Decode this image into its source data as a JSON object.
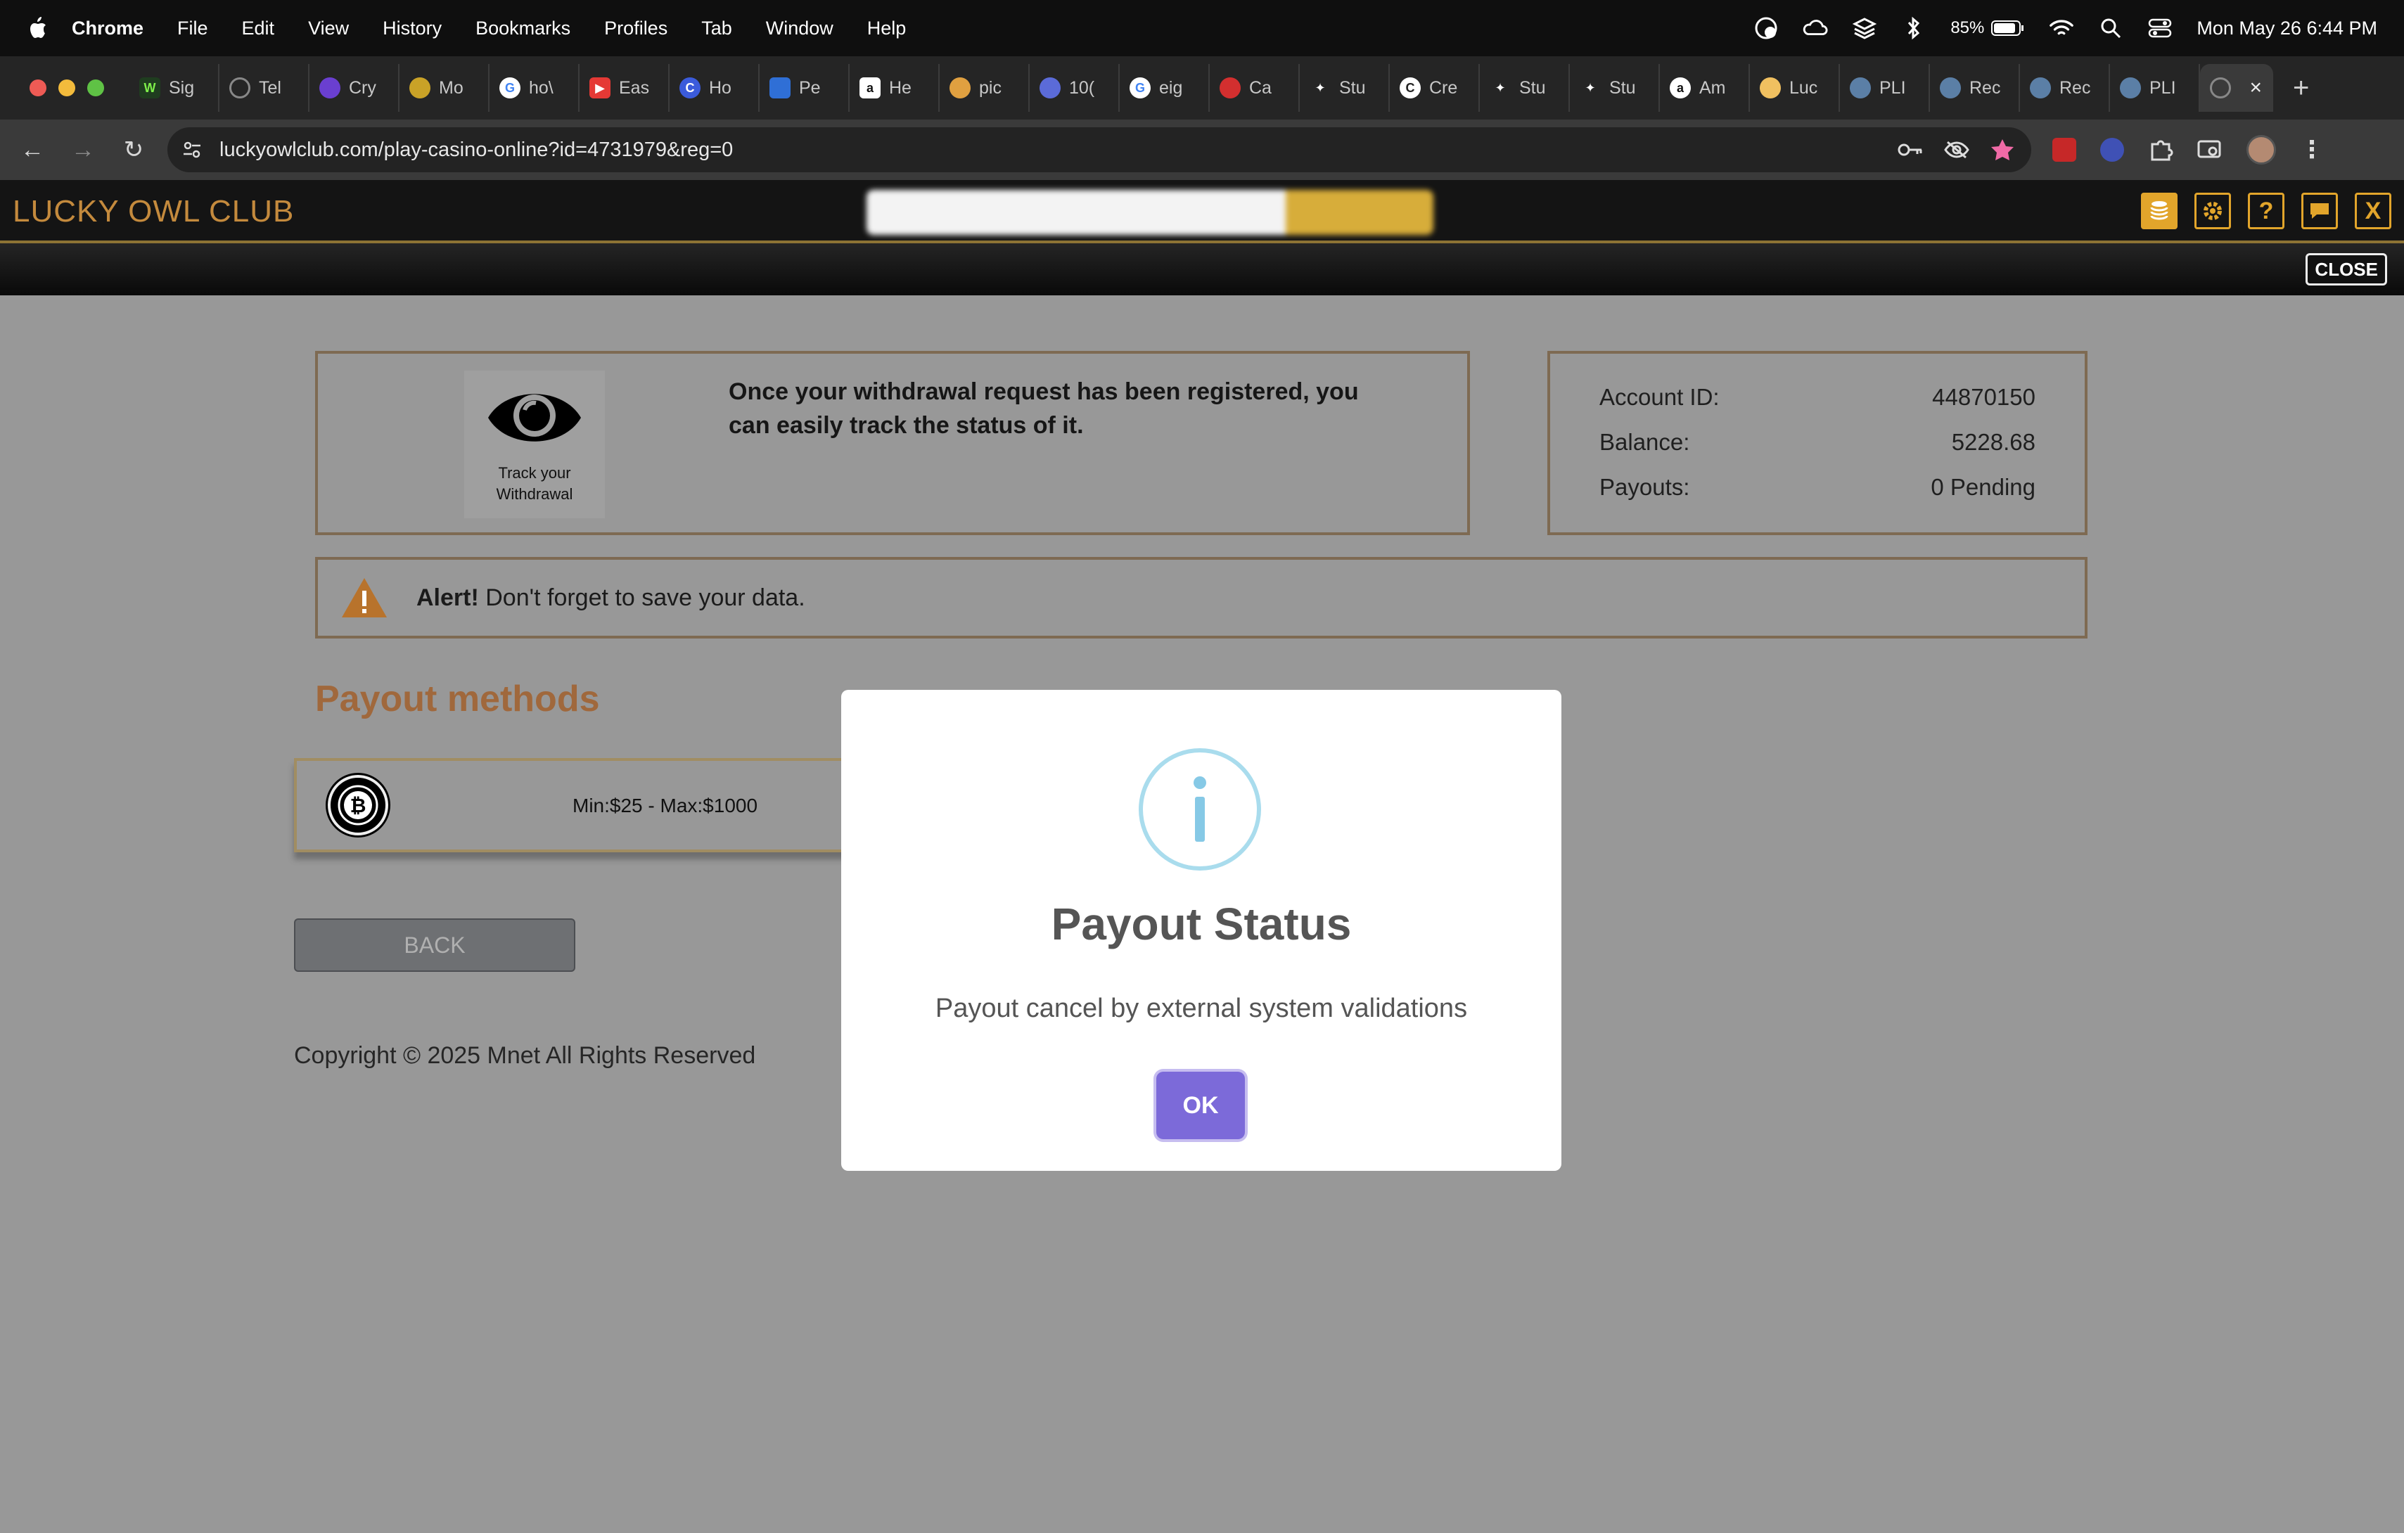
{
  "menubar": {
    "app": "Chrome",
    "items": [
      "File",
      "Edit",
      "View",
      "History",
      "Bookmarks",
      "Profiles",
      "Tab",
      "Window",
      "Help"
    ],
    "battery": "85%",
    "datetime": "Mon May 26  6:44 PM"
  },
  "tabs": [
    {
      "label": "Sig",
      "color": "#1f3d1f"
    },
    {
      "label": "Tel",
      "color": "#555555"
    },
    {
      "label": "Cry",
      "color": "#6a3fd0"
    },
    {
      "label": "Mo",
      "color": "#c9a227"
    },
    {
      "label": "ho\\",
      "color": "#4285f4"
    },
    {
      "label": "Eas",
      "color": "#e53935"
    },
    {
      "label": "Ho",
      "color": "#3b5bdb"
    },
    {
      "label": "Pe",
      "color": "#2f6fd6"
    },
    {
      "label": "He",
      "color": "#ffffff"
    },
    {
      "label": "pic",
      "color": "#e0a040"
    },
    {
      "label": "10(",
      "color": "#5b6bd8"
    },
    {
      "label": "eig",
      "color": "#4285f4"
    },
    {
      "label": "Ca",
      "color": "#d32f2f"
    },
    {
      "label": "Stu",
      "color": "#7b61ff"
    },
    {
      "label": "Cre",
      "color": "#ffffff"
    },
    {
      "label": "Stu",
      "color": "#7b61ff"
    },
    {
      "label": "Stu",
      "color": "#7b61ff"
    },
    {
      "label": "Am",
      "color": "#ffffff"
    },
    {
      "label": "Luc",
      "color": "#f0c060"
    },
    {
      "label": "PLI",
      "color": "#5b7fa6"
    },
    {
      "label": "Rec",
      "color": "#5b7fa6"
    },
    {
      "label": "Rec",
      "color": "#5b7fa6"
    },
    {
      "label": "PLI",
      "color": "#5b7fa6"
    }
  ],
  "address": {
    "url": "luckyowlclub.com/play-casino-online?id=4731979&reg=0"
  },
  "site": {
    "logo": "LUCKY OWL CLUB",
    "close_label": "CLOSE",
    "header_buttons": [
      "coins-icon",
      "gear-icon",
      "help-icon",
      "chat-icon",
      "close-x-icon"
    ],
    "header_x": "X",
    "header_help": "?"
  },
  "track": {
    "caption_line1": "Track your",
    "caption_line2": "Withdrawal",
    "message": "Once your withdrawal request has been registered, you can easily track the status of it."
  },
  "account": {
    "rows": [
      {
        "label": "Account ID:",
        "value": "44870150"
      },
      {
        "label": "Balance:",
        "value": "5228.68"
      },
      {
        "label": "Payouts:",
        "value": "0 Pending"
      }
    ]
  },
  "alert": {
    "strong": "Alert!",
    "text": " Don't forget to save your data."
  },
  "payout": {
    "heading": "Payout methods",
    "method_limits": "Min:$25 - Max:$1000",
    "back_label": "BACK"
  },
  "footer": {
    "copyright": "Copyright © 2025 Mnet All Rights Reserved"
  },
  "modal": {
    "title": "Payout Status",
    "text": "Payout cancel by external system validations",
    "ok_label": "OK"
  },
  "colors": {
    "accent_gold": "#e2a52b",
    "logo": "#c48a3d",
    "heading_brown": "#a0683c",
    "ok_purple": "#7c6ad9",
    "info_blue": "#8fd0e8"
  }
}
